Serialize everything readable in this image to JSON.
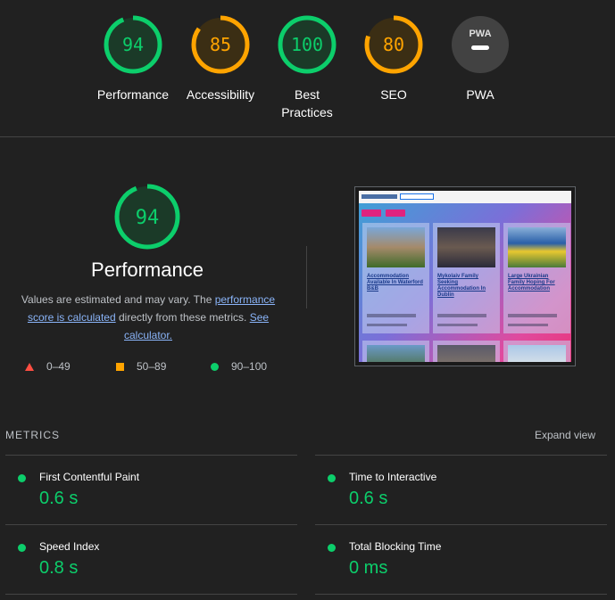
{
  "gauges": [
    {
      "name": "performance",
      "score": "94",
      "fraction": 0.94,
      "label": "Performance",
      "color": "#0cce6b",
      "fill": "#1b3a28"
    },
    {
      "name": "accessibility",
      "score": "85",
      "fraction": 0.85,
      "label": "Accessibility",
      "color": "#ffa400",
      "fill": "#3b2e14"
    },
    {
      "name": "best-practices",
      "score": "100",
      "fraction": 1.0,
      "label": "Best Practices",
      "color": "#0cce6b",
      "fill": "#1b3a28"
    },
    {
      "name": "seo",
      "score": "80",
      "fraction": 0.8,
      "label": "SEO",
      "color": "#ffa400",
      "fill": "#3b2e14"
    },
    {
      "name": "pwa",
      "score": "",
      "label": "PWA",
      "badge_text": "PWA",
      "color": "#9aa0a6",
      "fill": "#424242"
    }
  ],
  "main": {
    "score": "94",
    "fraction": 0.94,
    "title": "Performance",
    "desc_prefix": "Values are estimated and may vary. The ",
    "desc_link1": "performance score is calculated",
    "desc_mid": " directly from these metrics. ",
    "desc_link2": "See calculator."
  },
  "legend": {
    "fail": "0–49",
    "average": "50–89",
    "pass": "90–100"
  },
  "colors": {
    "pass": "#0cce6b",
    "average": "#ffa400",
    "fail": "#ff4e42"
  },
  "screenshot": {
    "cards": [
      {
        "title": "Accommodation Available In Waterford B&B"
      },
      {
        "title": "Mykolaiv Family Seeking Accommodation In Dublin"
      },
      {
        "title": "Large Ukrainian Family Hoping For Accommodation"
      }
    ]
  },
  "metrics": {
    "heading": "METRICS",
    "expand_label": "Expand view",
    "items": [
      {
        "label": "First Contentful Paint",
        "value": "0.6 s"
      },
      {
        "label": "Time to Interactive",
        "value": "0.6 s"
      },
      {
        "label": "Speed Index",
        "value": "0.8 s"
      },
      {
        "label": "Total Blocking Time",
        "value": "0 ms"
      }
    ]
  }
}
